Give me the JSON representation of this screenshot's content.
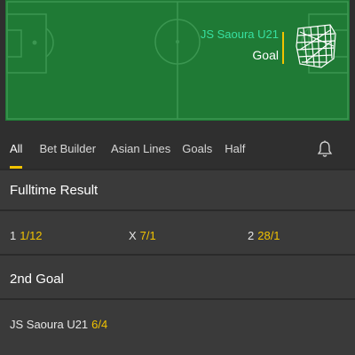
{
  "match_event": {
    "team": "JS Saoura U21",
    "event": "Goal",
    "accent_team_color": "#37e0a0",
    "marker_color": "#f2c300",
    "pitch_color": "#1f7a35",
    "goal_icon": "goal-net-icon"
  },
  "tabs": [
    {
      "label": "All",
      "active": true
    },
    {
      "label": "Bet Builder",
      "active": false
    },
    {
      "label": "Asian Lines",
      "active": false
    },
    {
      "label": "Goals",
      "active": false
    },
    {
      "label": "Half",
      "active": false
    }
  ],
  "notification_icon": "bell-icon",
  "markets": {
    "fulltime": {
      "title": "Fulltime Result",
      "outcomes": [
        {
          "label": "1",
          "odds": "1/12"
        },
        {
          "label": "X",
          "odds": "7/1"
        },
        {
          "label": "2",
          "odds": "28/1"
        }
      ]
    },
    "second_goal": {
      "title": "2nd Goal",
      "outcomes": [
        {
          "label": "JS Saoura U21",
          "odds": "6/4"
        }
      ]
    }
  },
  "colors": {
    "odds": "#f2c300",
    "background": "#3a3a3a",
    "tabbar": "#2f2f2f"
  }
}
